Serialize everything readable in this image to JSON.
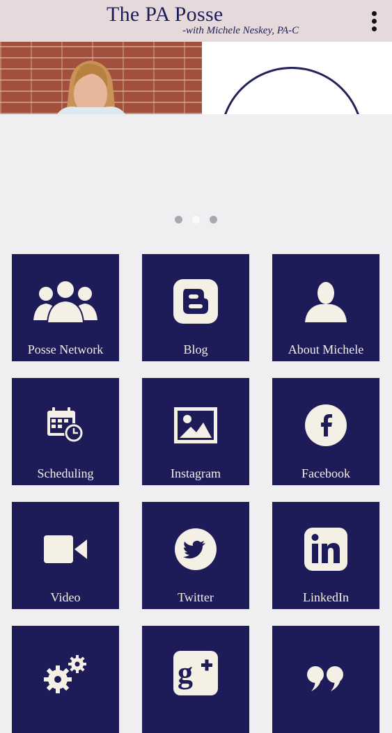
{
  "header": {
    "title": "The PA Posse",
    "subtitle": "-with Michele Neskey, PA-C",
    "menu_icon": "more-vert-icon"
  },
  "colors": {
    "header_bg": "#e6d9dc",
    "tile_bg": "#1d1c58",
    "tile_fg": "#f4f0e6",
    "page_bg": "#efeff1"
  },
  "banner": {
    "slide_count": 3,
    "active_slide": 2
  },
  "tiles": [
    {
      "label": "Posse Network",
      "icon": "group-icon"
    },
    {
      "label": "Blog",
      "icon": "blogger-icon"
    },
    {
      "label": "About Michele",
      "icon": "person-icon"
    },
    {
      "label": "Scheduling",
      "icon": "calendar-clock-icon"
    },
    {
      "label": "Instagram",
      "icon": "image-icon"
    },
    {
      "label": "Facebook",
      "icon": "facebook-icon"
    },
    {
      "label": "Video",
      "icon": "video-camera-icon"
    },
    {
      "label": "Twitter",
      "icon": "twitter-icon"
    },
    {
      "label": "LinkedIn",
      "icon": "linkedin-icon"
    },
    {
      "label": "",
      "icon": "gears-icon"
    },
    {
      "label": "",
      "icon": "google-plus-icon"
    },
    {
      "label": "",
      "icon": "quote-icon"
    }
  ]
}
